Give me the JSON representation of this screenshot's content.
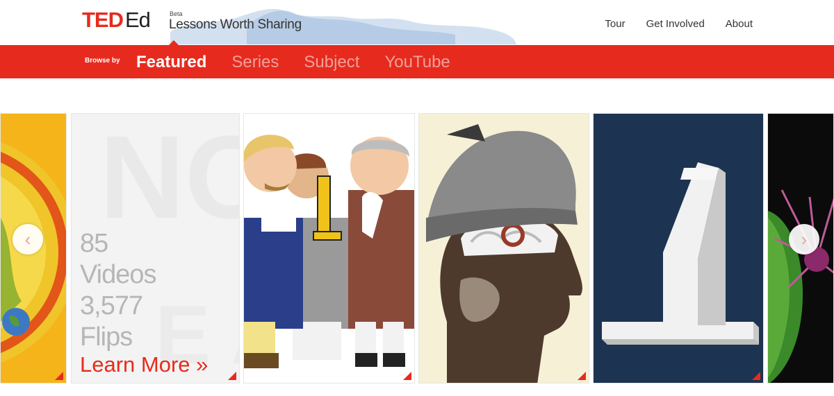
{
  "header": {
    "logo_ted": "TED",
    "logo_ed": "Ed",
    "beta": "Beta",
    "tagline": "Lessons Worth Sharing",
    "nav": [
      "Tour",
      "Get Involved",
      "About"
    ]
  },
  "browse": {
    "label": "Browse by",
    "tabs": [
      "Featured",
      "Series",
      "Subject",
      "YouTube"
    ],
    "active": "Featured"
  },
  "stats": {
    "videos_count": "85",
    "videos_label": "Videos",
    "flips_count": "3,577",
    "flips_label": "Flips",
    "learn_more": "Learn More »"
  },
  "carousel": {
    "prev_icon": "chevron-left-icon",
    "next_icon": "chevron-right-icon",
    "prev_glyph": "‹",
    "next_glyph": "›"
  },
  "colors": {
    "brand_red": "#e62b1e",
    "stat_gray": "#b6b6b6"
  }
}
